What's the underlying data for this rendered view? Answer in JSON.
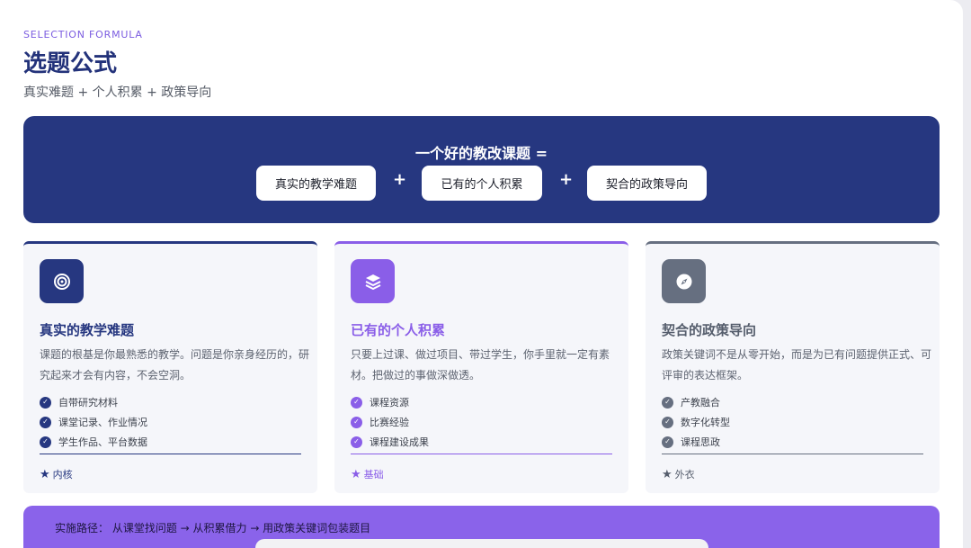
{
  "header": {
    "eyebrow": "SELECTION FORMULA",
    "title": "选题公式",
    "subtitle": "真实难题 + 个人积累 + 政策导向"
  },
  "formula": {
    "title": "一个好的教改课题 =",
    "items": [
      "真实的教学难题",
      "已有的个人积累",
      "契合的政策导向"
    ],
    "operator": "+"
  },
  "cards": [
    {
      "icon": "target-icon",
      "color": "#263780",
      "title": "真实的教学难题",
      "desc": "课题的根基是你最熟悉的教学。问题是你亲身经历的，研究起来才会有内容，不会空洞。",
      "items": [
        "自带研究材料",
        "课堂记录、作业情况",
        "学生作品、平台数据"
      ],
      "footer": "内核"
    },
    {
      "icon": "layers-icon",
      "color": "#8a5ee8",
      "title": "已有的个人积累",
      "desc": "只要上过课、做过项目、带过学生，你手里就一定有素材。把做过的事做深做透。",
      "items": [
        "课程资源",
        "比赛经验",
        "课程建设成果"
      ],
      "footer": "基础"
    },
    {
      "icon": "compass-icon",
      "color": "#666f80",
      "title": "契合的政策导向",
      "desc": "政策关键词不是从零开始，而是为已有问题提供正式、可评审的表达框架。",
      "items": [
        "产教融合",
        "数字化转型",
        "课程思政"
      ],
      "footer": "外衣"
    }
  ],
  "path": {
    "text": "实施路径： 从课堂找问题 → 从积累借力 → 用政策关键词包装题目"
  }
}
